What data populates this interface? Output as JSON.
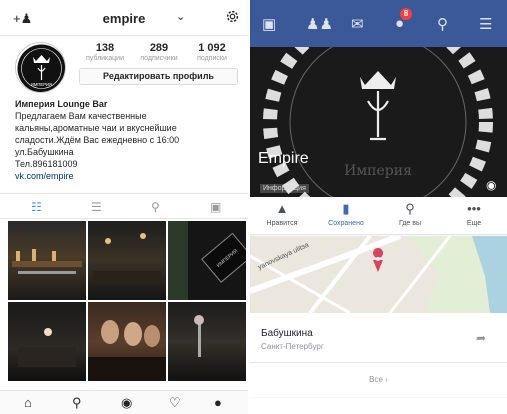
{
  "instagram": {
    "username": "empire",
    "stats": [
      {
        "value": "138",
        "label": "публикации"
      },
      {
        "value": "289",
        "label": "подписчики"
      },
      {
        "value": "1 092",
        "label": "подписки"
      }
    ],
    "edit_profile_label": "Редактировать профиль",
    "bio": {
      "name": "Империя Lounge Bar",
      "lines": [
        "Предлагаем Вам качественные",
        "кальяны,ароматные чаи и вкуснейшие",
        "сладости.Ждём Вас ежедневно с 16:00",
        "ул.Бабушкина",
        "Тел.896181009"
      ],
      "link": "vk.com/empire"
    },
    "avatar_text": "ИМПЕРИЯ",
    "photo_sign": "ИМПЕРИЯ",
    "tabs": [
      {
        "icon": "grid-icon",
        "active": true
      },
      {
        "icon": "list-icon",
        "active": false
      },
      {
        "icon": "location-pin-icon",
        "active": false
      },
      {
        "icon": "tagged-icon",
        "active": false
      }
    ],
    "bottom_nav": [
      "home-icon",
      "search-icon",
      "camera-icon",
      "heart-icon",
      "profile-icon"
    ]
  },
  "facebook": {
    "notification_count": "8",
    "cover": {
      "category": "Информация",
      "title": "Empire",
      "watermark": "Империя"
    },
    "actions": [
      {
        "label": "Нравится",
        "icon": "thumbs-up-icon",
        "active": false
      },
      {
        "label": "Сохранено",
        "icon": "bookmark-icon",
        "active": true
      },
      {
        "label": "Где вы",
        "icon": "location-icon",
        "active": false
      },
      {
        "label": "Еще",
        "icon": "more-icon",
        "active": false
      }
    ],
    "map_street": "yanovskaya ulitsa",
    "address": {
      "street": "Бабушкина",
      "city": "Санкт-Петербург"
    },
    "see_all_label": "Все",
    "colors": {
      "header": "#3b5998",
      "accent": "#4267b2",
      "badge": "#fa3e3e"
    }
  }
}
